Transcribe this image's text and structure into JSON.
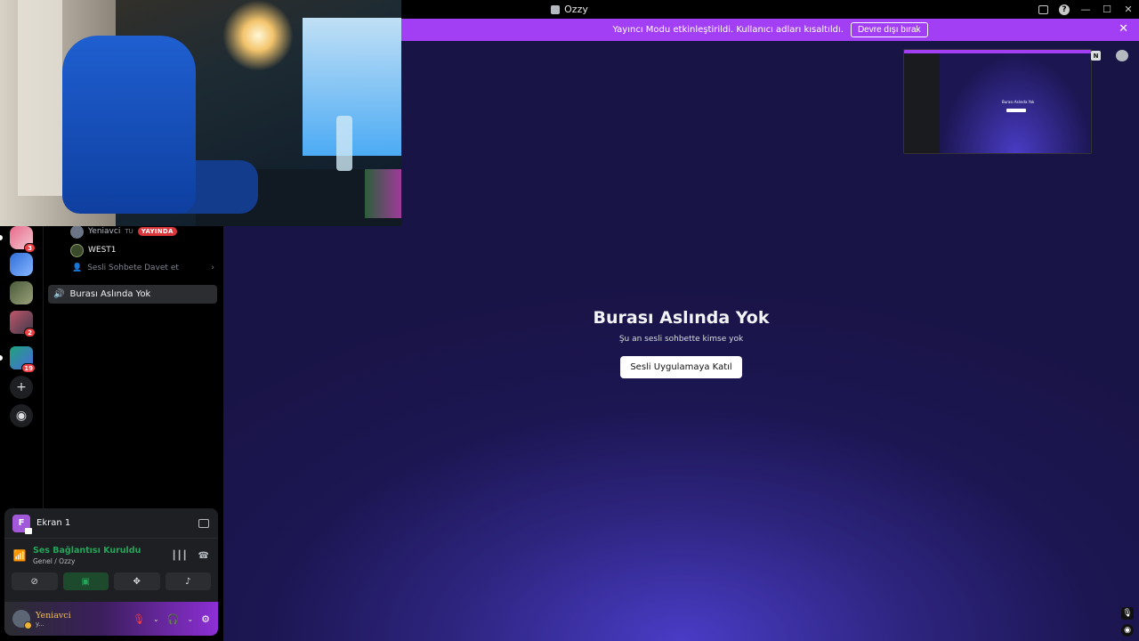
{
  "window": {
    "title": "Ozzy"
  },
  "banner": {
    "text": "Yayıncı Modu etkinleştirildi. Kullanıcı adları kısaltıldı.",
    "button": "Devre dışı bırak"
  },
  "servers": [
    {
      "badge": "3"
    },
    {
      "badge": ""
    },
    {
      "badge": ""
    },
    {
      "badge": "2"
    },
    {
      "badge": "19"
    }
  ],
  "voice_members": [
    {
      "name": "Yeniavci",
      "tag": "TU",
      "live": "YAYINDA"
    },
    {
      "name": "WEST1"
    }
  ],
  "invite": "Sesli Sohbete Davet et",
  "voice_channel": "Burası Aslında Yok",
  "panel": {
    "screen_name": "Ekran 1",
    "screen_initial": "F",
    "connection_status": "Ses Bağlantısı Kuruldu",
    "connection_location": "Genel / Ozzy"
  },
  "user": {
    "name": "Yeniavci",
    "status": "y..."
  },
  "stage": {
    "title": "Burası Aslında Yok",
    "subtitle": "Şu an sesli sohbette kimse yok",
    "join_button": "Sesli Uygulamaya Katıl"
  },
  "preview": {
    "title": "Burası Aslında Yok",
    "corner_letter": "N"
  },
  "colors": {
    "accent": "#a23ff5",
    "connected": "#23a55a",
    "live": "#da373c"
  }
}
